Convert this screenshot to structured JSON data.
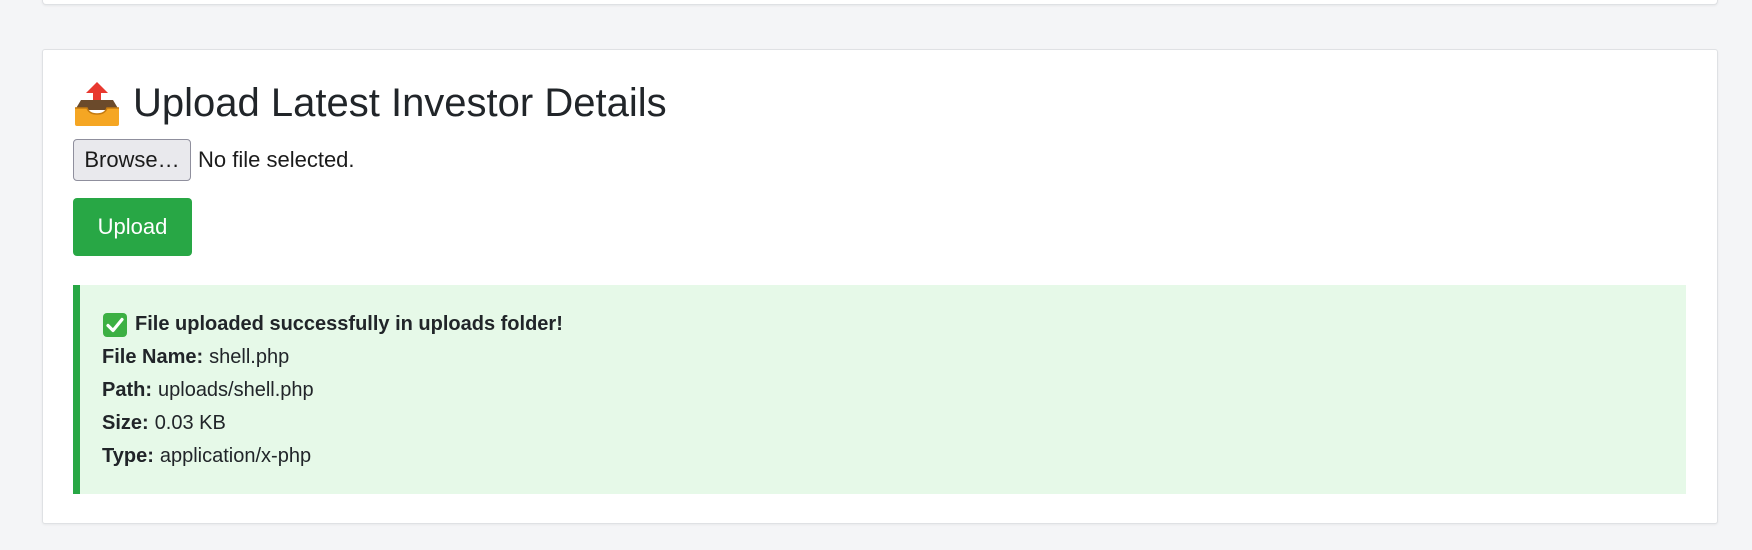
{
  "upload_section": {
    "title": "Upload Latest Investor Details",
    "title_icon": "outbox-tray-icon",
    "file_input": {
      "browse_label": "Browse…",
      "status": "No file selected."
    },
    "upload_button_label": "Upload",
    "accent_color": "#28a745"
  },
  "result": {
    "icon": "check-mark-icon",
    "message": "File uploaded successfully in uploads folder!",
    "fields": [
      {
        "label": "File Name:",
        "value": "shell.php"
      },
      {
        "label": "Path:",
        "value": "uploads/shell.php"
      },
      {
        "label": "Size:",
        "value": "0.03 KB"
      },
      {
        "label": "Type:",
        "value": "application/x-php"
      }
    ],
    "background_color": "#e6f9e8"
  }
}
